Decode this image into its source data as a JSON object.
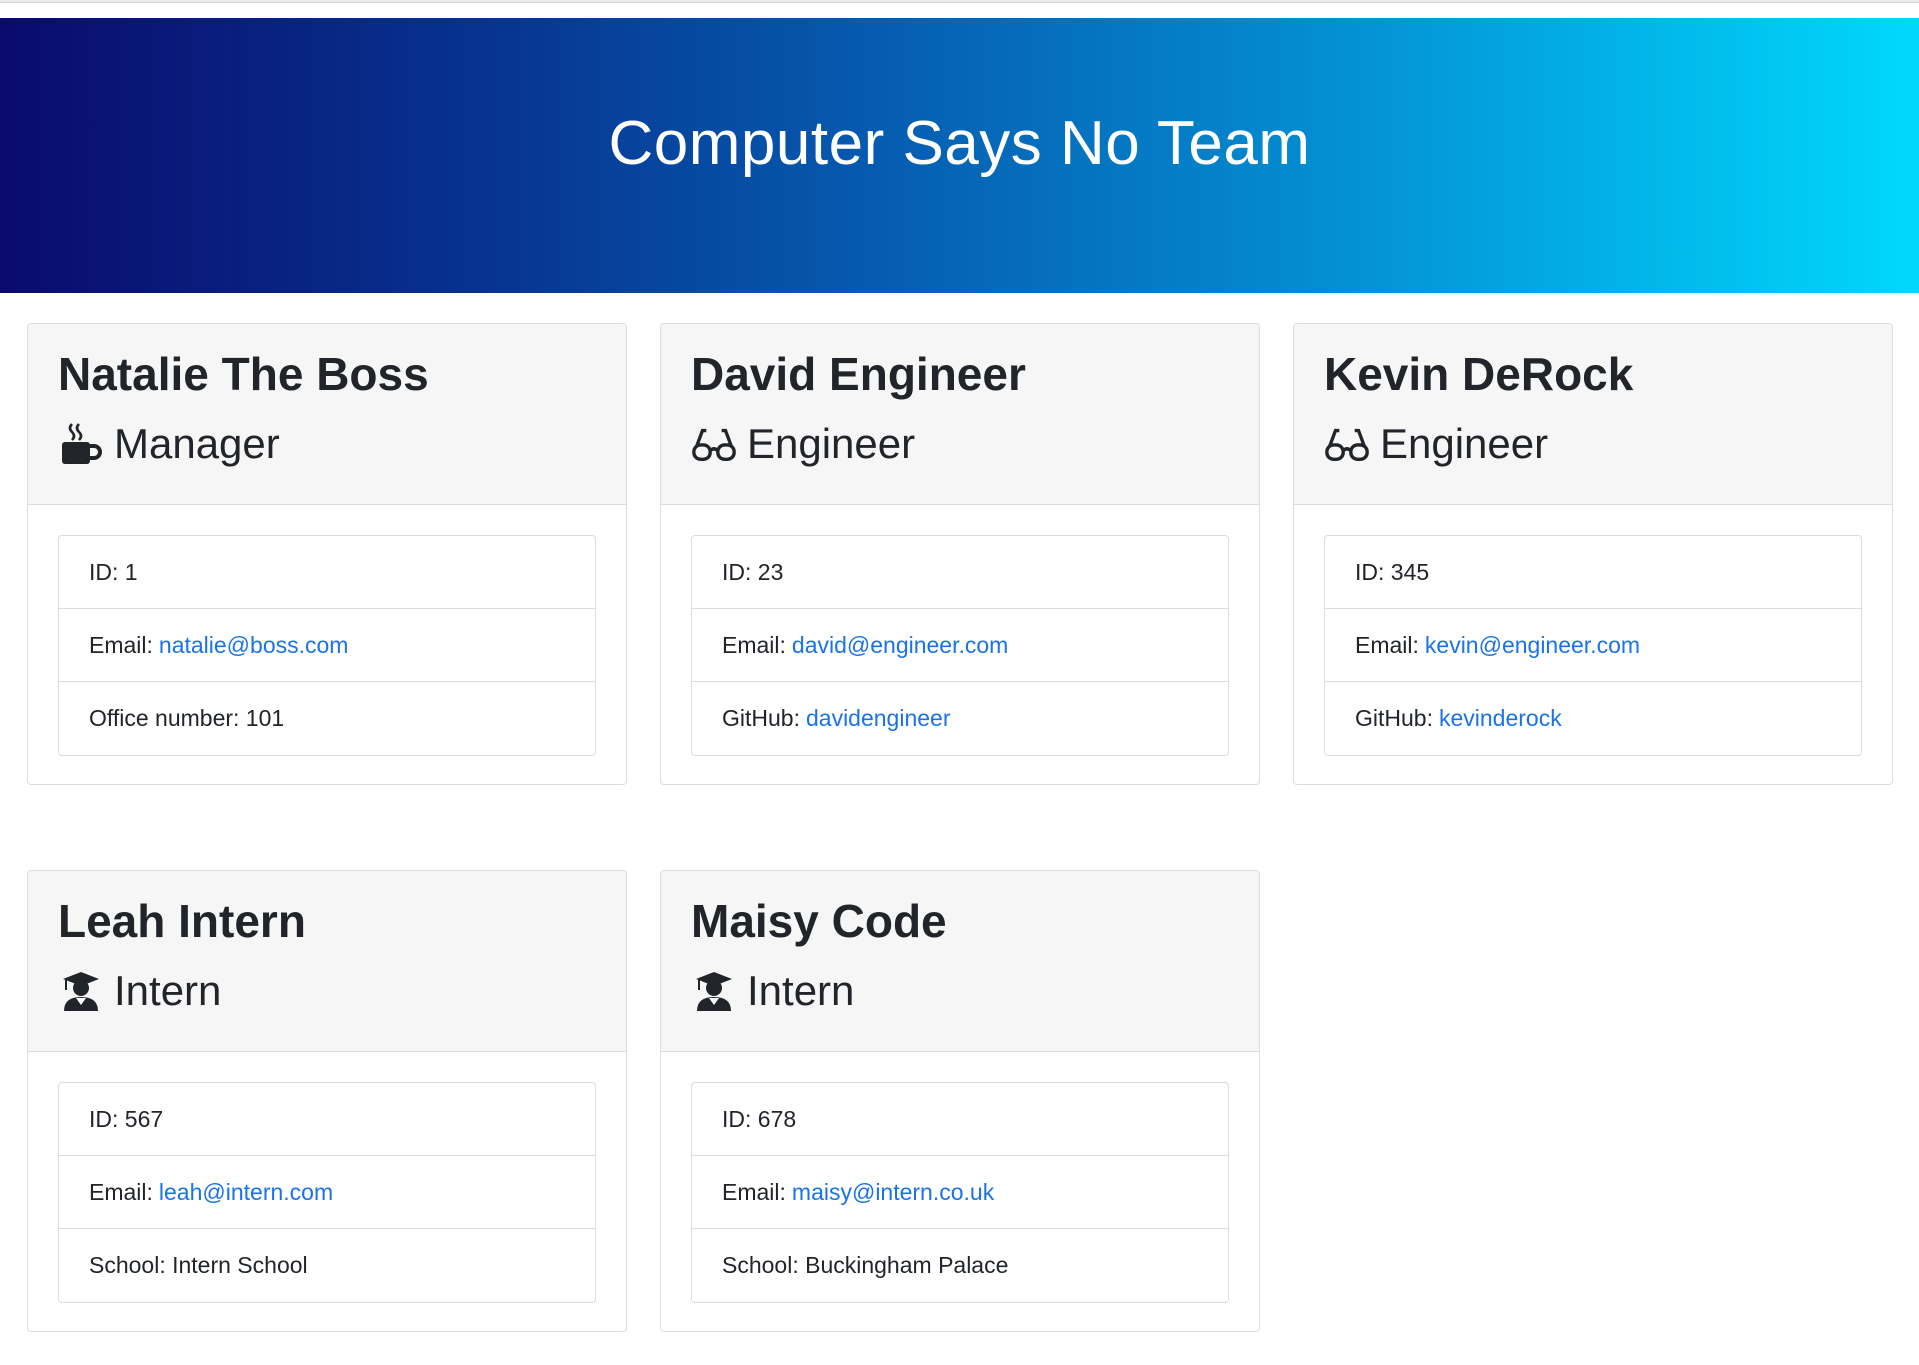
{
  "header": {
    "title": "Computer Says No Team"
  },
  "cards": [
    {
      "name": "Natalie The Boss",
      "role": "Manager",
      "icon": "coffee-icon",
      "id_label": "ID: 1",
      "email_label": "Email:",
      "email": "natalie@boss.com",
      "extra_label": "Office number: 101",
      "extra_link": ""
    },
    {
      "name": "David Engineer",
      "role": "Engineer",
      "icon": "glasses-icon",
      "id_label": "ID: 23",
      "email_label": "Email:",
      "email": "david@engineer.com",
      "extra_label": "GitHub:",
      "extra_link": "davidengineer"
    },
    {
      "name": "Kevin DeRock",
      "role": "Engineer",
      "icon": "glasses-icon",
      "id_label": "ID: 345",
      "email_label": "Email:",
      "email": "kevin@engineer.com",
      "extra_label": "GitHub:",
      "extra_link": "kevinderock"
    },
    {
      "name": "Leah Intern",
      "role": "Intern",
      "icon": "graduate-icon",
      "id_label": "ID: 567",
      "email_label": "Email:",
      "email": "leah@intern.com",
      "extra_label": "School: Intern School",
      "extra_link": ""
    },
    {
      "name": "Maisy Code",
      "role": "Intern",
      "icon": "graduate-icon",
      "id_label": "ID: 678",
      "email_label": "Email:",
      "email": "maisy@intern.co.uk",
      "extra_label": "School: Buckingham Palace",
      "extra_link": ""
    }
  ],
  "colors": {
    "link": "#1a73e8",
    "gradient_start": "#0a0a6e",
    "gradient_end": "#00d8ff"
  }
}
